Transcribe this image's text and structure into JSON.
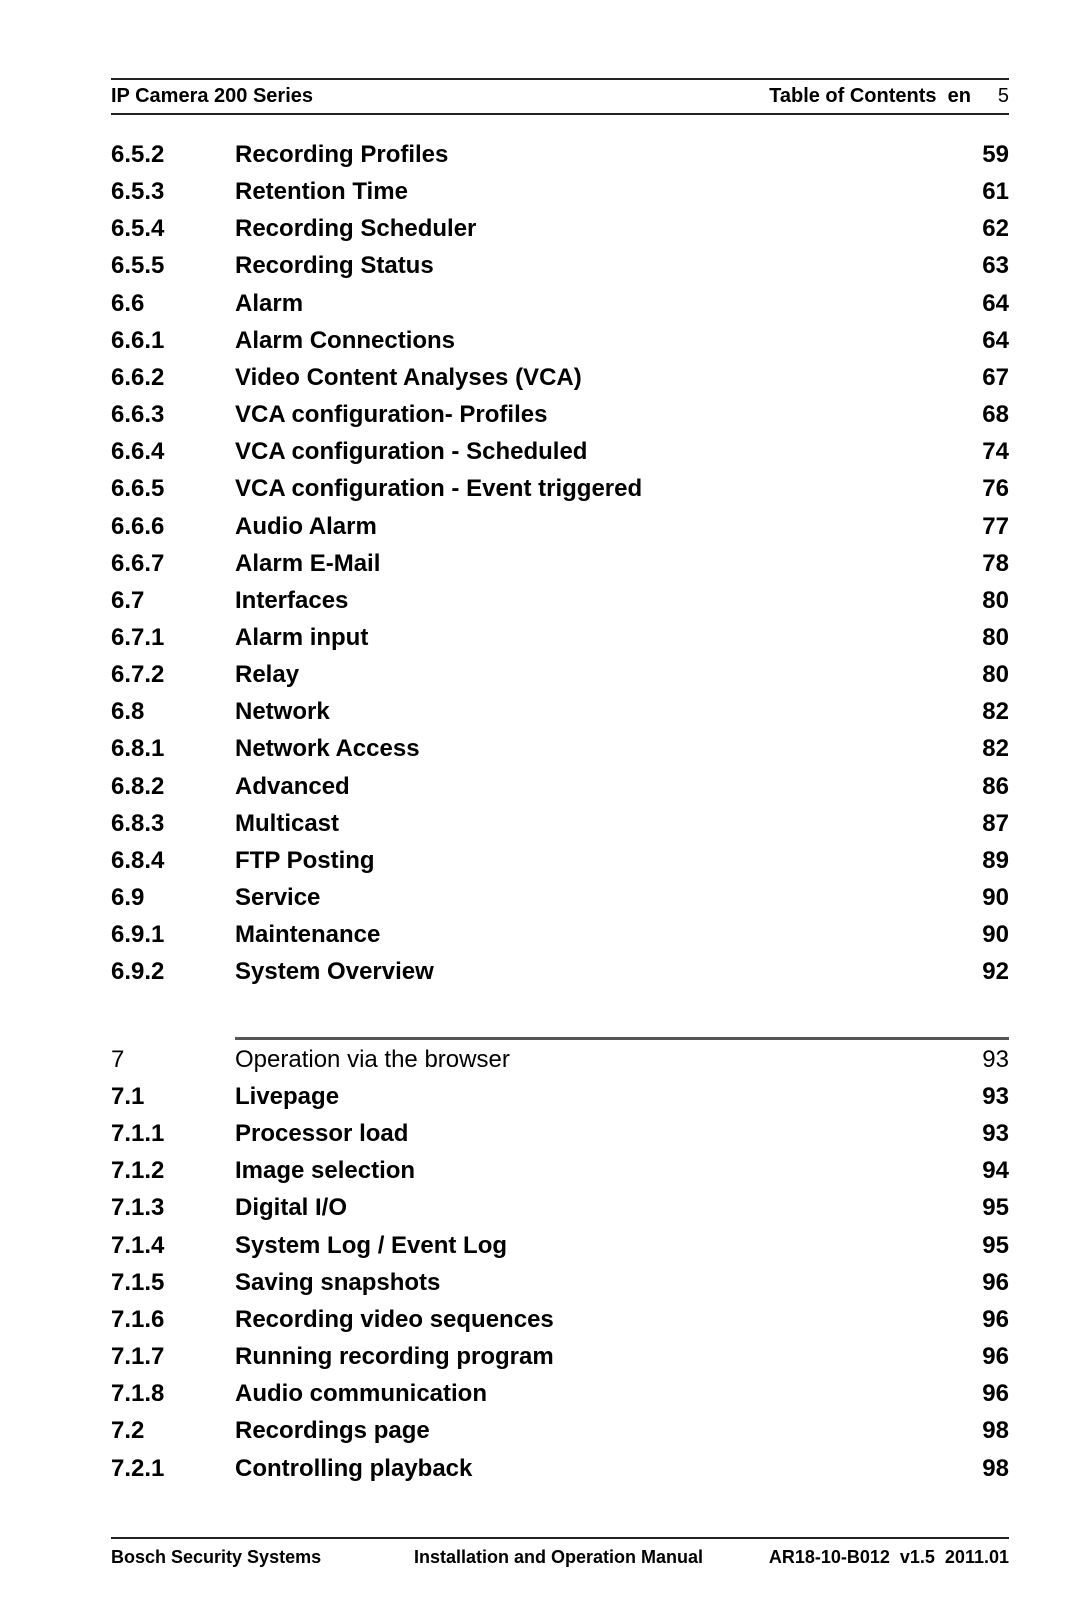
{
  "header": {
    "title": "IP Camera 200 Series",
    "section": "Table of Contents",
    "language": "en",
    "page_number": "5"
  },
  "toc_block1": [
    {
      "num": "6.5.2",
      "title": "Recording Profiles",
      "page": "59"
    },
    {
      "num": "6.5.3",
      "title": "Retention Time",
      "page": "61"
    },
    {
      "num": "6.5.4",
      "title": "Recording Scheduler",
      "page": "62"
    },
    {
      "num": "6.5.5",
      "title": "Recording Status",
      "page": "63"
    },
    {
      "num": "6.6",
      "title": "Alarm",
      "page": "64"
    },
    {
      "num": "6.6.1",
      "title": "Alarm Connections",
      "page": "64"
    },
    {
      "num": "6.6.2",
      "title": "Video Content Analyses (VCA)",
      "page": "67"
    },
    {
      "num": "6.6.3",
      "title": "VCA configuration- Profiles",
      "page": "68"
    },
    {
      "num": "6.6.4",
      "title": "VCA configuration - Scheduled",
      "page": "74"
    },
    {
      "num": "6.6.5",
      "title": "VCA configuration - Event triggered",
      "page": "76"
    },
    {
      "num": "6.6.6",
      "title": "Audio Alarm",
      "page": "77"
    },
    {
      "num": "6.6.7",
      "title": "Alarm E-Mail",
      "page": "78"
    },
    {
      "num": "6.7",
      "title": "Interfaces",
      "page": "80"
    },
    {
      "num": "6.7.1",
      "title": "Alarm input",
      "page": "80"
    },
    {
      "num": "6.7.2",
      "title": "Relay",
      "page": "80"
    },
    {
      "num": "6.8",
      "title": "Network",
      "page": "82"
    },
    {
      "num": "6.8.1",
      "title": "Network Access",
      "page": "82"
    },
    {
      "num": "6.8.2",
      "title": "Advanced",
      "page": "86"
    },
    {
      "num": "6.8.3",
      "title": "Multicast",
      "page": "87"
    },
    {
      "num": "6.8.4",
      "title": "FTP Posting",
      "page": "89"
    },
    {
      "num": "6.9",
      "title": "Service",
      "page": "90"
    },
    {
      "num": "6.9.1",
      "title": "Maintenance",
      "page": "90"
    },
    {
      "num": "6.9.2",
      "title": "System Overview",
      "page": "92"
    }
  ],
  "chapter": {
    "num": "7",
    "title": "Operation via the browser",
    "page": "93"
  },
  "toc_block2": [
    {
      "num": "7.1",
      "title": "Livepage",
      "page": "93"
    },
    {
      "num": "7.1.1",
      "title": "Processor load",
      "page": "93"
    },
    {
      "num": "7.1.2",
      "title": "Image selection",
      "page": "94"
    },
    {
      "num": "7.1.3",
      "title": "Digital I/O",
      "page": "95"
    },
    {
      "num": "7.1.4",
      "title": "System Log / Event Log",
      "page": "95"
    },
    {
      "num": "7.1.5",
      "title": "Saving snapshots",
      "page": "96"
    },
    {
      "num": "7.1.6",
      "title": "Recording video sequences",
      "page": "96"
    },
    {
      "num": "7.1.7",
      "title": "Running recording program",
      "page": "96"
    },
    {
      "num": "7.1.8",
      "title": "Audio communication",
      "page": "96"
    },
    {
      "num": "7.2",
      "title": "Recordings page",
      "page": "98"
    },
    {
      "num": "7.2.1",
      "title": "Controlling playback",
      "page": "98"
    }
  ],
  "footer": {
    "company": "Bosch Security Systems",
    "manual": "Installation and Operation Manual",
    "doc_id": "AR18-10-B012  v1.5  2011.01"
  }
}
